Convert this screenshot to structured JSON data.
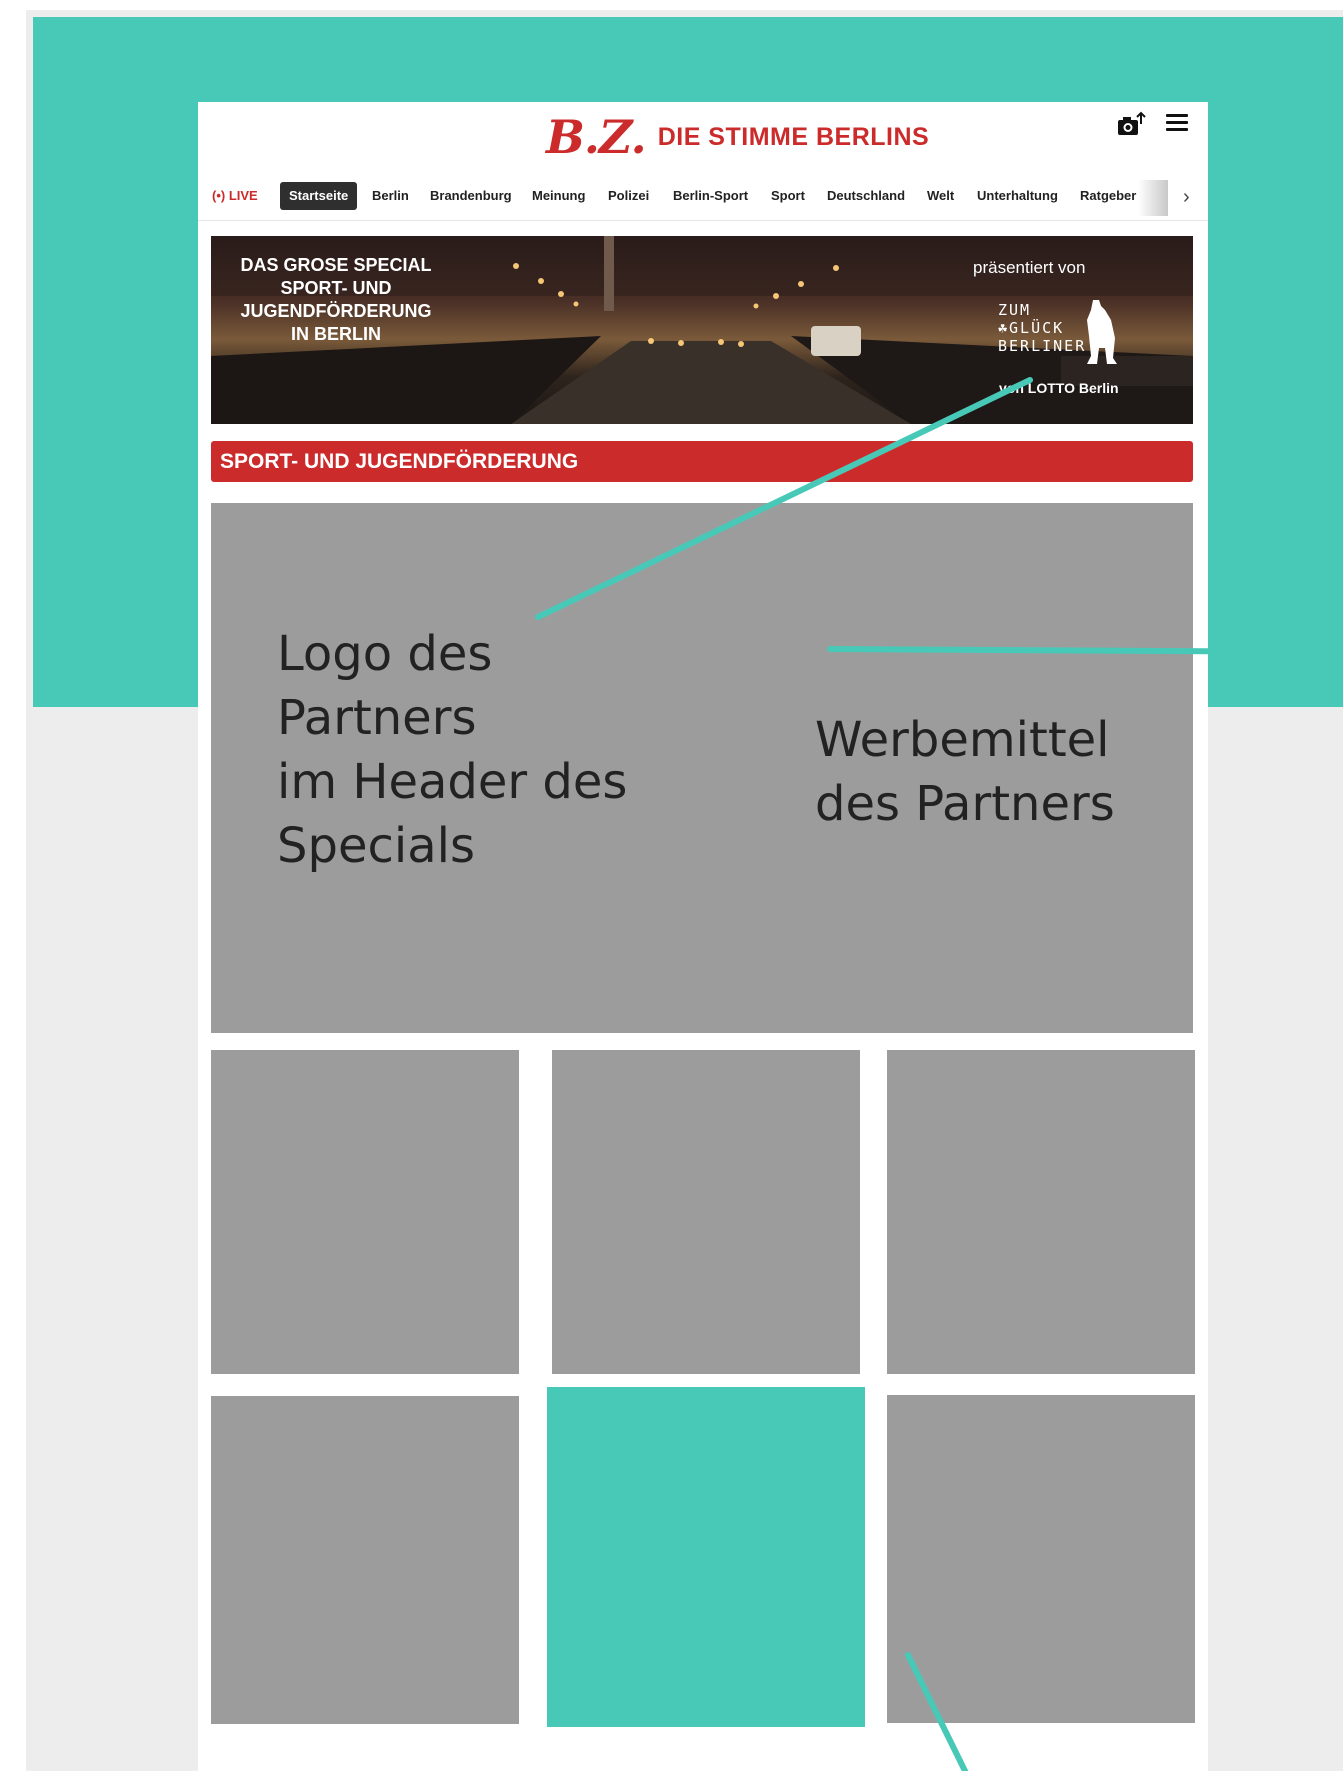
{
  "header": {
    "logo_text": "B.Z.",
    "claim": "DIE STIMME BERLINS"
  },
  "icons": [
    "camera-upload-icon",
    "hamburger-menu-icon",
    "live-broadcast-icon",
    "chevron-right-icon"
  ],
  "nav": {
    "live": "(•) LIVE",
    "items": [
      "Startseite",
      "Berlin",
      "Brandenburg",
      "Meinung",
      "Polizei",
      "Berlin-Sport",
      "Sport",
      "Deutschland",
      "Welt",
      "Unterhaltung",
      "Ratgeber"
    ],
    "active": "Startseite"
  },
  "banner": {
    "title_lines": [
      "DAS GROSE SPECIAL",
      "SPORT- UND",
      "JUGENDFÖRDERUNG",
      "IN BERLIN"
    ],
    "presented_by": "präsentiert von",
    "partner_lines": [
      "ZUM",
      "☘GLÜCK",
      "BERLINER"
    ],
    "partner_sub": "von LOTTO Berlin"
  },
  "section": {
    "title": "SPORT- UND JUGENDFÖRDERUNG"
  },
  "annotations": {
    "logo_partner": "Logo des\nPartners\nim Header des\nSpecials",
    "ad_partner": "Werbemittel\ndes Partners"
  },
  "colors": {
    "accent_teal": "#48c9b8",
    "brand_red": "#cc2b2b",
    "placeholder_gray": "#9d9c9c"
  }
}
